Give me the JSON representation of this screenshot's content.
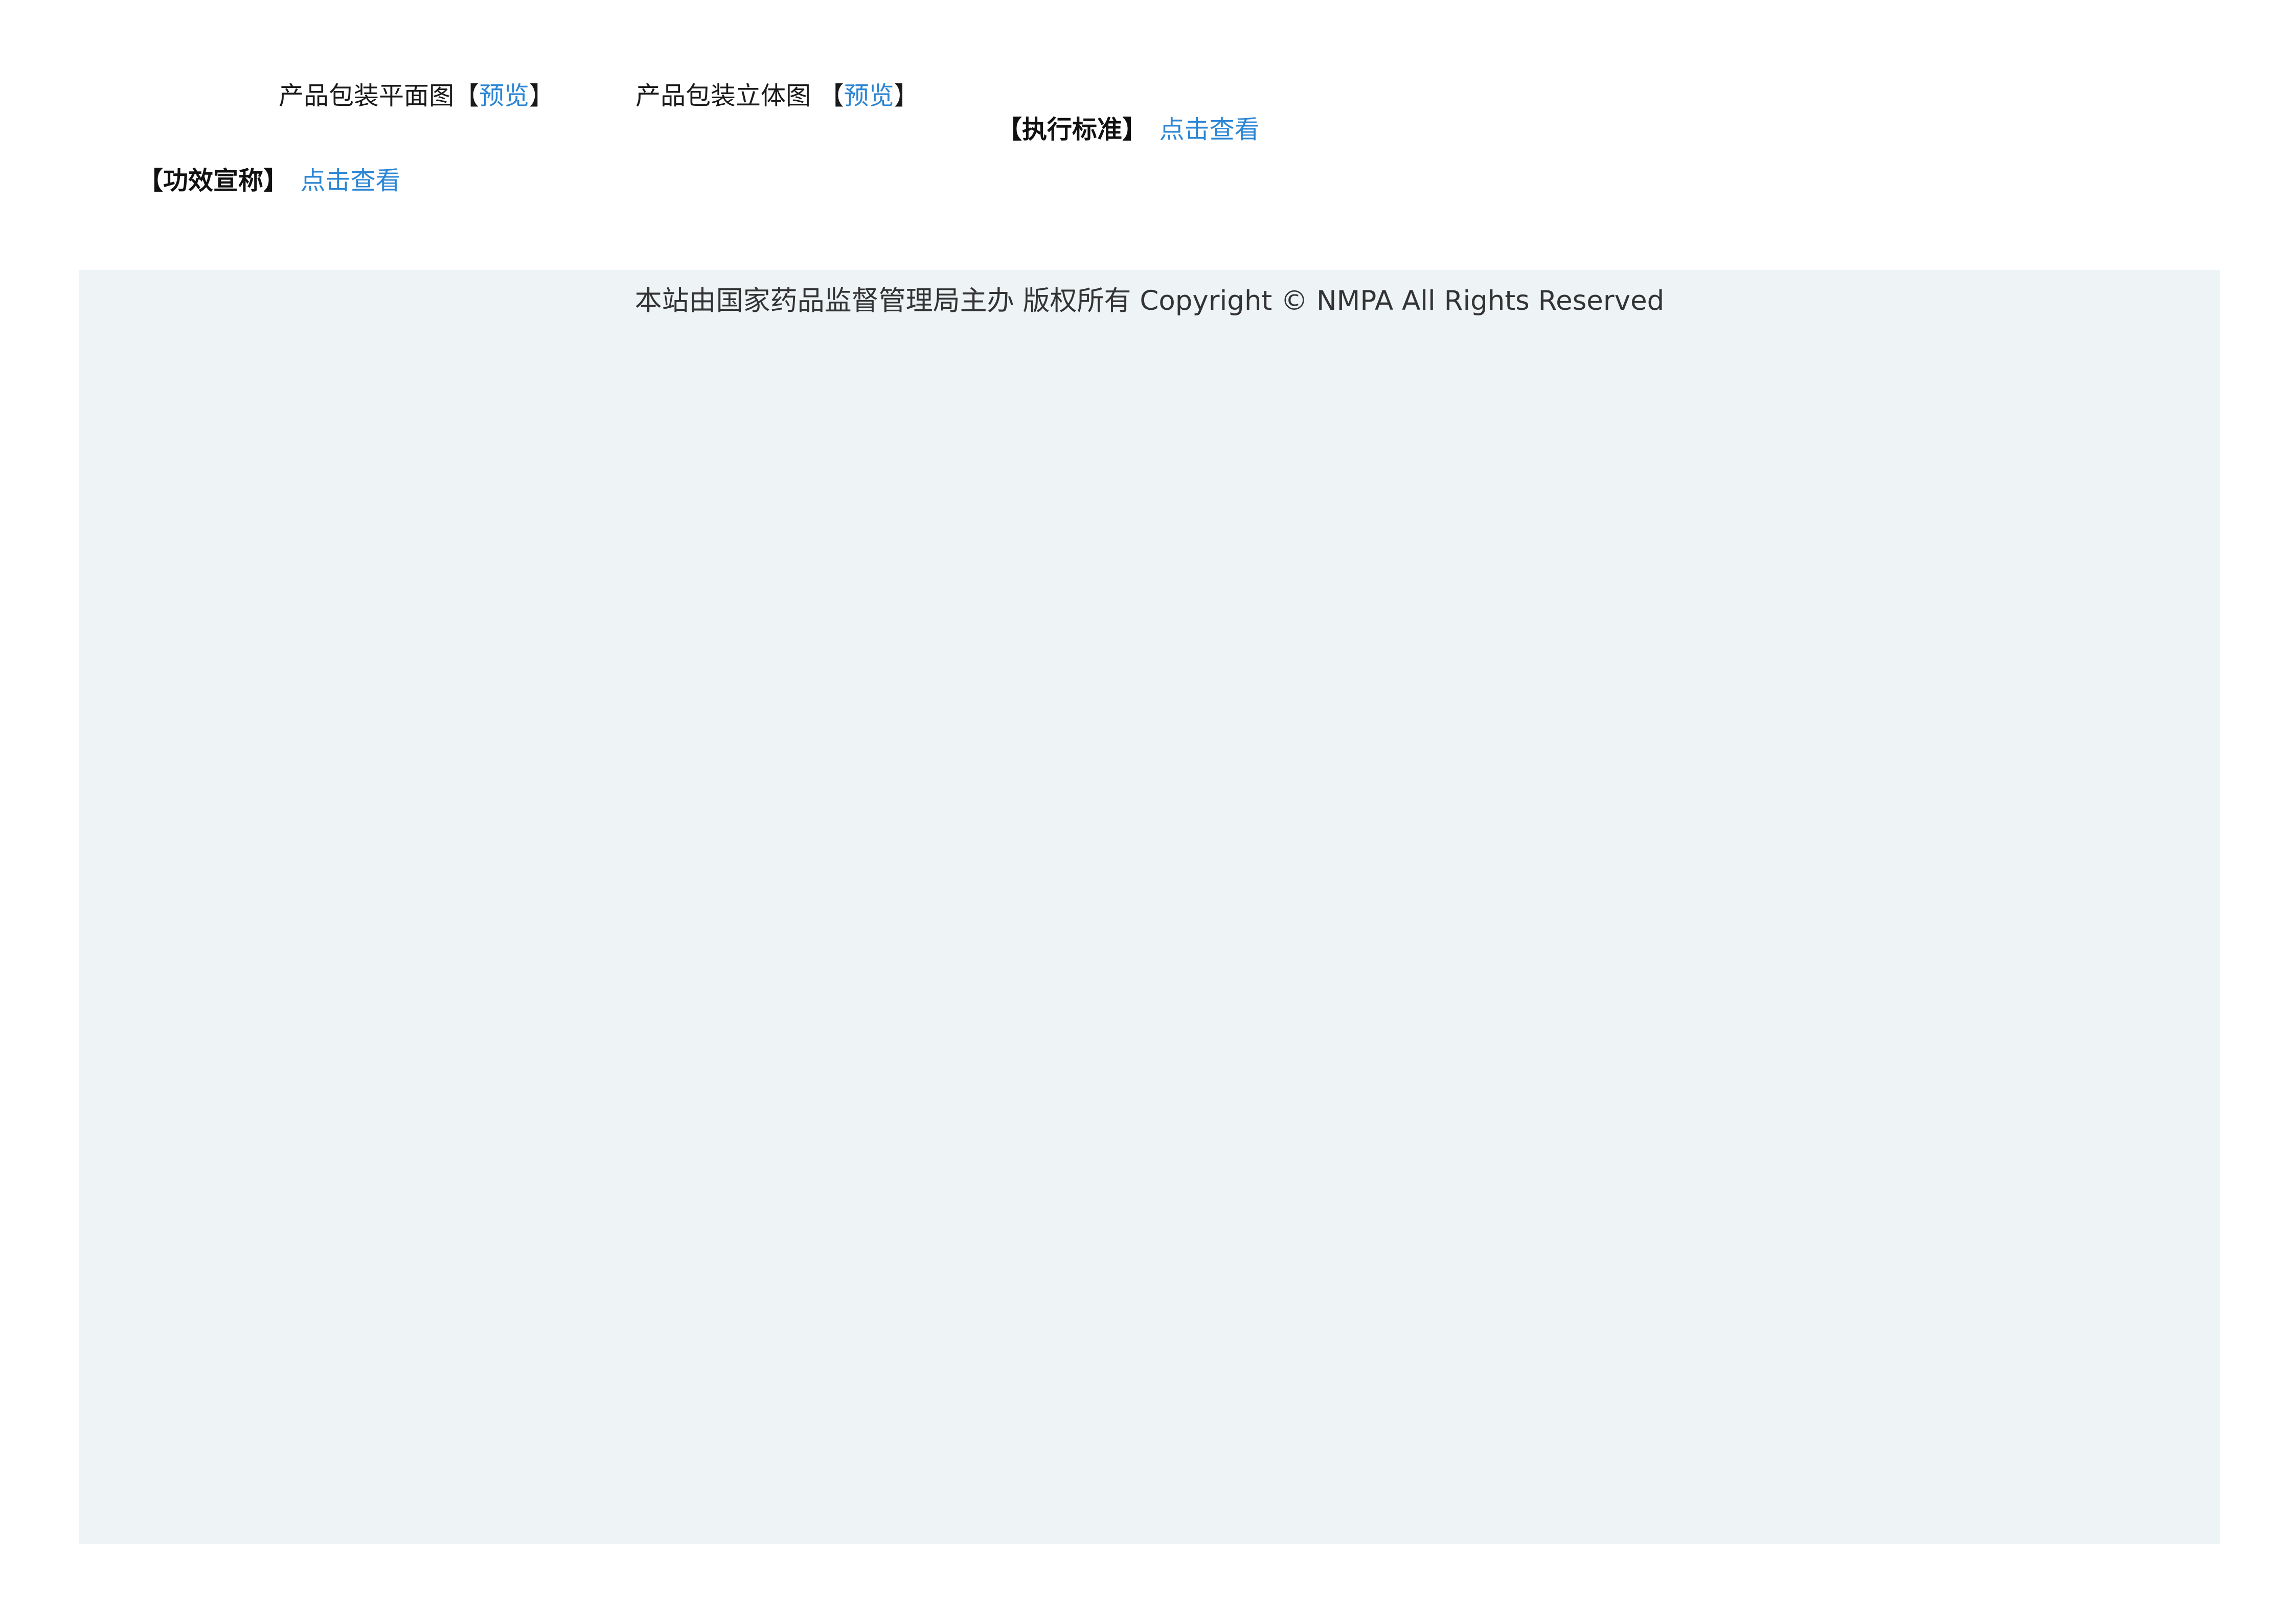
{
  "packaging": {
    "flat_label": "产品包装平面图",
    "flat_preview": "预览",
    "stereo_label": "产品包装立体图 ",
    "stereo_preview": "预览",
    "bracket_open": "【",
    "bracket_close": "】"
  },
  "standard": {
    "label": "【执行标准】",
    "link": "点击查看"
  },
  "efficacy": {
    "label": "【功效宣称】",
    "link": "点击查看"
  },
  "footer": {
    "text": "本站由国家药品监督管理局主办 版权所有 Copyright © NMPA All Rights Reserved"
  },
  "colors": {
    "link": "#2b86d4",
    "footer_bg": "#eef3f6"
  }
}
